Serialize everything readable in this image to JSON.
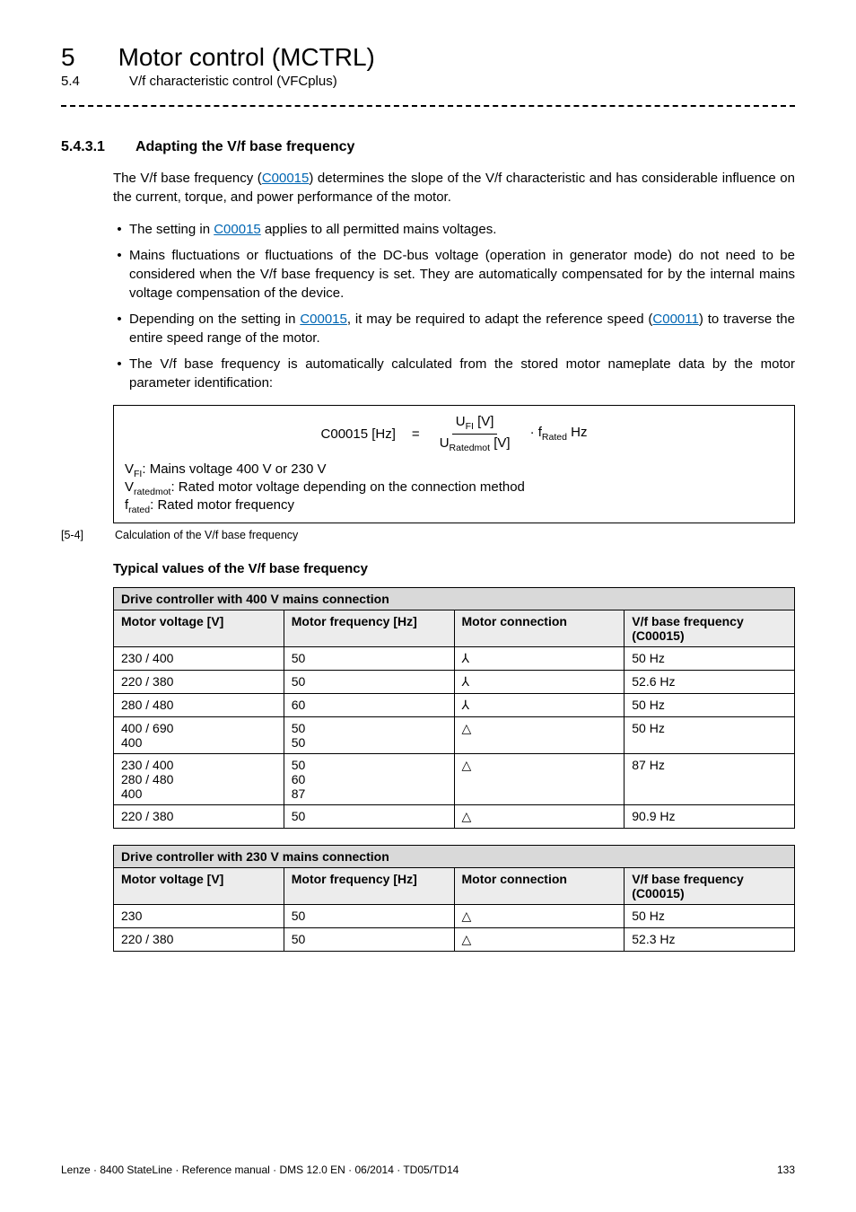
{
  "chapter": {
    "num": "5",
    "title": "Motor control (MCTRL)"
  },
  "subsection": {
    "num": "5.4",
    "title": "V/f characteristic control (VFCplus)"
  },
  "section": {
    "num": "5.4.3.1",
    "title": "Adapting the V/f base frequency",
    "intro_a": "The V/f base frequency (",
    "intro_link": "C00015",
    "intro_b": ") determines the slope of the V/f characteristic and has considerable influence on the current, torque, and power performance of the motor."
  },
  "bullets": [
    {
      "pre": "The setting in ",
      "link": "C00015",
      "post": " applies to all permitted mains voltages."
    },
    {
      "text": "Mains fluctuations or fluctuations of the DC-bus voltage (operation in generator mode) do not need to be considered when the V/f base frequency is set. They are automatically compensated for by the internal mains voltage compensation of the device."
    },
    {
      "pre": "Depending on the setting in ",
      "link": "C00015",
      "mid": ", it may be required to adapt the reference speed (",
      "link2": "C00011",
      "post": ") to traverse the entire speed range of the motor."
    },
    {
      "text": "The V/f base frequency is automatically calculated from the stored motor nameplate data by the motor parameter identification:"
    }
  ],
  "formula": {
    "lhs": "C00015 [Hz]",
    "eq": "=",
    "num": "U_FI [V]",
    "den": "U_Ratedmot [V]",
    "tail": "· f_Rated Hz",
    "note1": "V_FI: Mains voltage 400 V or 230 V",
    "note2": "V_ratedmot: Rated motor voltage depending on the connection method",
    "note3": "f_rated: Rated motor frequency"
  },
  "figcap": {
    "tag": "[5-4]",
    "text": "Calculation of the V/f base frequency"
  },
  "typical_title": "Typical values of the V/f base frequency",
  "symbols": {
    "star": "⅄",
    "delta": "△"
  },
  "table400": {
    "banner": "Drive controller with 400 V mains connection",
    "cols": [
      "Motor voltage [V]",
      "Motor frequency [Hz]",
      "Motor connection",
      "V/f base frequency (C00015)"
    ],
    "rows": [
      {
        "mv": "230 / 400",
        "mf": "50",
        "mc": "star",
        "vf": "50 Hz"
      },
      {
        "mv": "220 / 380",
        "mf": "50",
        "mc": "star",
        "vf": "52.6 Hz"
      },
      {
        "mv": "280 / 480",
        "mf": "60",
        "mc": "star",
        "vf": "50 Hz"
      },
      {
        "mv": "400 / 690\n400",
        "mf": "50\n50",
        "mc": "delta",
        "vf": "50 Hz"
      },
      {
        "mv": "230 / 400\n280 / 480\n400",
        "mf": "50\n60\n87",
        "mc": "delta",
        "vf": "87 Hz"
      },
      {
        "mv": "220 / 380",
        "mf": "50",
        "mc": "delta",
        "vf": "90.9 Hz"
      }
    ]
  },
  "table230": {
    "banner": "Drive controller with 230 V mains connection",
    "cols": [
      "Motor voltage [V]",
      "Motor frequency [Hz]",
      "Motor connection",
      "V/f base frequency (C00015)"
    ],
    "rows": [
      {
        "mv": "230",
        "mf": "50",
        "mc": "delta",
        "vf": "50 Hz"
      },
      {
        "mv": "220 / 380",
        "mf": "50",
        "mc": "delta",
        "vf": "52.3 Hz"
      }
    ]
  },
  "footer": {
    "left": "Lenze · 8400 StateLine · Reference manual · DMS 12.0 EN · 06/2014 · TD05/TD14",
    "right": "133"
  }
}
